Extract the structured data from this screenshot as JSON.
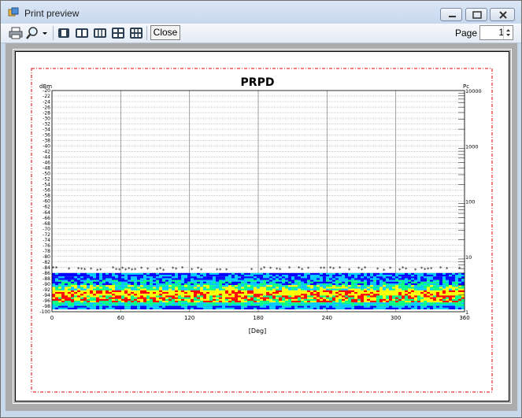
{
  "window": {
    "title": "Print preview"
  },
  "toolbar": {
    "print_icon": "printer-icon",
    "zoom_icon": "magnifier-icon",
    "close_label": "Close",
    "page_label": "Page",
    "page_value": "1"
  },
  "chart_data": {
    "type": "heatmap",
    "title": "PRPD",
    "xlabel": "[Deg]",
    "ylabel_left": "dBm",
    "ylabel_right": "Pc",
    "x_ticks": [
      "0",
      "60",
      "120",
      "180",
      "240",
      "300",
      "360"
    ],
    "xlim": [
      0,
      360
    ],
    "ylim_left": [
      -100,
      -20
    ],
    "y_left_ticks": [
      "-20",
      "-22",
      "-24",
      "-26",
      "-28",
      "-30",
      "-32",
      "-34",
      "-36",
      "-38",
      "-40",
      "-42",
      "-44",
      "-46",
      "-48",
      "-50",
      "-52",
      "-54",
      "-56",
      "-58",
      "-60",
      "-62",
      "-64",
      "-66",
      "-68",
      "-70",
      "-72",
      "-74",
      "-76",
      "-78",
      "-80",
      "-82",
      "-84",
      "-86",
      "-88",
      "-90",
      "-92",
      "-94",
      "-96",
      "-98",
      "-100"
    ],
    "y_right_ticks": [
      "10000",
      "1000",
      "100",
      "10",
      "1"
    ],
    "y_right_scale": "log",
    "grid": true,
    "density_band_dbm": [
      -99,
      -86
    ],
    "color_scale": [
      "#0000ff",
      "#00c8ff",
      "#00ff80",
      "#ffff00",
      "#ff0000"
    ]
  }
}
